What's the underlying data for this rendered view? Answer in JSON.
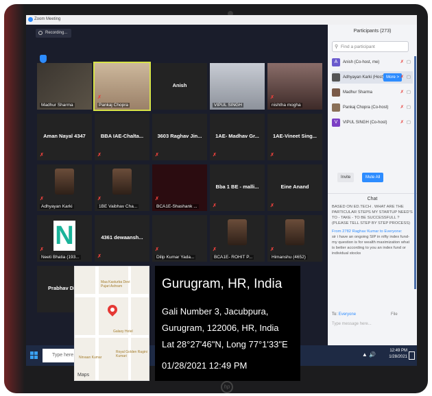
{
  "window": {
    "title": "Zoom Meeting"
  },
  "recording": {
    "label": "Recording..."
  },
  "tiles": [
    {
      "label": "Madhur Sharma",
      "style": "vid1",
      "mode": "name",
      "muted": false
    },
    {
      "label": "Pankaj Chopra",
      "style": "vid2",
      "mode": "name",
      "muted": true,
      "active": true
    },
    {
      "label": "Anish",
      "mode": "center",
      "muted": false
    },
    {
      "label": "VIPUL SINGH",
      "style": "vid3",
      "mode": "name",
      "muted": false
    },
    {
      "label": "nishtha mogha",
      "style": "vid4",
      "mode": "name",
      "muted": true
    },
    {
      "label": "Aman Nayal 4347",
      "mode": "center",
      "muted": true
    },
    {
      "label": "BBA IAE-Chalta...",
      "mode": "center",
      "muted": true
    },
    {
      "label": "3603 Raghav Jin...",
      "mode": "center",
      "muted": true
    },
    {
      "label": "1AE- Madhav Gr...",
      "mode": "center",
      "muted": true
    },
    {
      "label": "1AE-Vineet Sing...",
      "mode": "center",
      "muted": true
    },
    {
      "label": "Adhyayan Karki",
      "mode": "name",
      "avatar": true,
      "muted": true
    },
    {
      "label": "1BE Vaibhav Cha...",
      "mode": "name",
      "avatar": true,
      "muted": true
    },
    {
      "label": "BCA1E-Shashank ...",
      "style": "dark1",
      "mode": "name",
      "muted": true
    },
    {
      "label": "Bba 1 BE - malli...",
      "mode": "center",
      "muted": true
    },
    {
      "label": "Eine Anand",
      "mode": "center",
      "muted": true
    },
    {
      "label": "Neeti Bhatia (193...",
      "mode": "name",
      "bigN": "N",
      "muted": true
    },
    {
      "label": "4361 dewaansh...",
      "mode": "center",
      "muted": true
    },
    {
      "label": "Dilip Kumar Yada...",
      "mode": "name",
      "muted": true
    },
    {
      "label": "BCA1E- ROHIT P...",
      "mode": "name",
      "avatar": true,
      "muted": true
    },
    {
      "label": "Himanshu (4652)",
      "mode": "name",
      "avatar": true,
      "muted": true
    },
    {
      "label": "Prabhav Dixit",
      "mode": "center",
      "muted": false
    }
  ],
  "participants": {
    "title": "Participants (273)",
    "search_placeholder": "Find a participant",
    "rows": [
      {
        "initial": "A",
        "color": "#6a5acd",
        "name": "Anish (Co-host, me)"
      },
      {
        "initial": "",
        "color": "#555555",
        "name": "Adhyayan Karki (Host)",
        "more": "More >"
      },
      {
        "initial": "",
        "color": "#7a5a48",
        "name": "Madhur Sharma"
      },
      {
        "initial": "",
        "color": "#8a7058",
        "name": "Pankaj Chopra (Co-host)"
      },
      {
        "initial": "V",
        "color": "#7b3fc4",
        "name": "VIPUL SINGH (Co-host)"
      }
    ],
    "invite": "Invite",
    "mute_all": "Mute All"
  },
  "chat": {
    "title": "Chat",
    "message1": "BASED ON ED.TECH . WHAT ARE THE PARTICULAR STEPS MY STARTUP NEED'S TO - TAKE - TO BE SUCCESSFULL ? (PLEASE TELL STEP BY STEP PROCESS)",
    "from2": "From 2782 Raghav Kumar to Everyone:",
    "message2": "sir i have an ongoing SIP in nifty index fund- my question is for wealth maximization what is better according to you an index fund or individual stocks",
    "to_label": "To:",
    "to_value": "Everyone",
    "file": "File",
    "placeholder": "Type message here..."
  },
  "taskbar": {
    "search": "Type here to search",
    "time": "12:49 PM",
    "date": "1/28/2021"
  },
  "map": {
    "label1": "Maa Kasturba Devi Pujari Ashram",
    "label2": "Galaxy Hotel",
    "label3": "Nirvaan Kumar",
    "label4": "Royal Golden Ragini Kumari",
    "brand": "Maps"
  },
  "gps": {
    "city": "Gurugram, HR, India",
    "line1": "Gali Number 3, Jacubpura,",
    "line2": "Gurugram, 122006, HR, India",
    "line3": "Lat 28°27'46\"N, Long 77°1'33\"E",
    "datetime": "01/28/2021 12:49 PM"
  }
}
